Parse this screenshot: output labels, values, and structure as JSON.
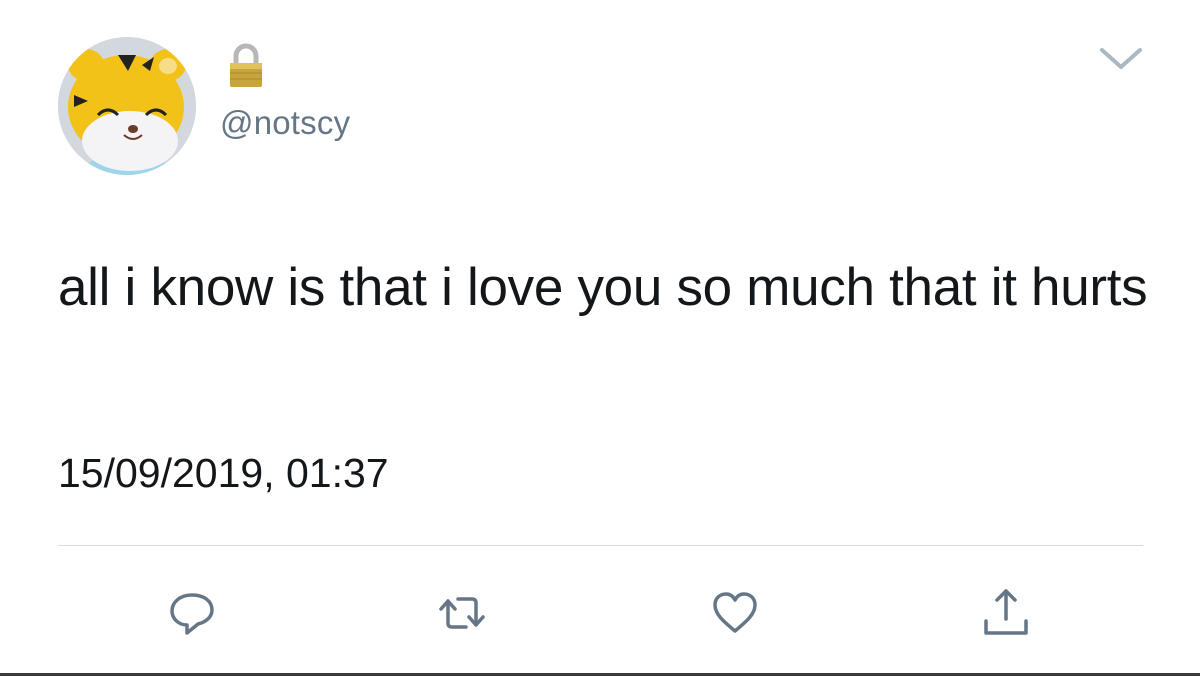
{
  "tweet": {
    "handle": "@notscy",
    "text": "all i know is that i love you so much that it hurts",
    "timestamp": "15/09/2019, 01:37",
    "locked": true
  },
  "icons": {
    "lock": "lock-icon",
    "menu": "chevron-down-icon",
    "reply": "reply-icon",
    "retweet": "retweet-icon",
    "like": "heart-icon",
    "share": "share-icon"
  },
  "colors": {
    "text": "#14171a",
    "secondary": "#657786",
    "icon": "#657786",
    "divider": "#d6dbe0",
    "avatar_yellow": "#f3c219"
  }
}
